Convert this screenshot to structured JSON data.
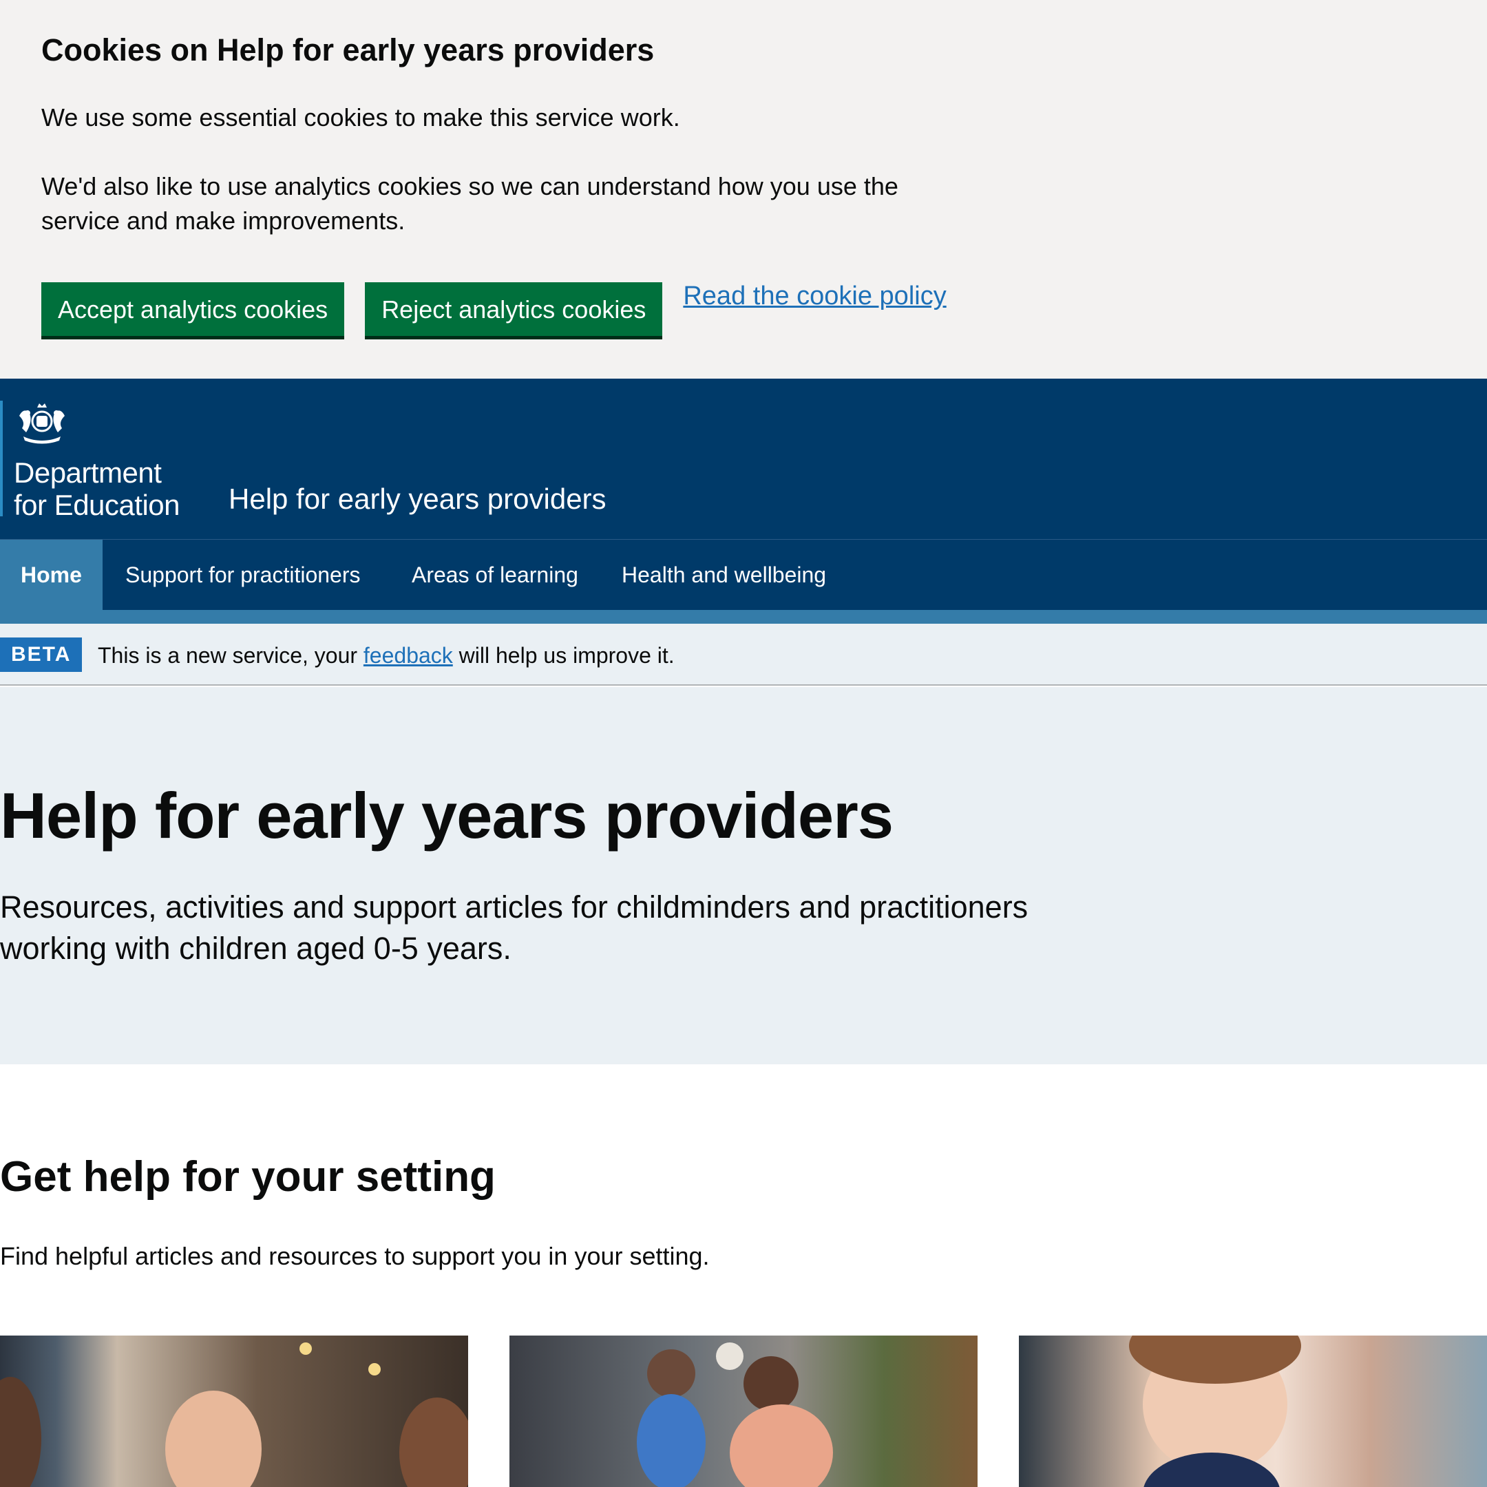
{
  "cookie_banner": {
    "title": "Cookies on Help for early years providers",
    "paragraph_1": "We use some essential cookies to make this service work.",
    "paragraph_2": "We'd also like to use analytics cookies so we can understand how you use the service and make improvements.",
    "accept_label": "Accept analytics cookies",
    "reject_label": "Reject analytics cookies",
    "policy_link": "Read the cookie policy"
  },
  "header": {
    "org_line_1": "Department",
    "org_line_2": "for Education",
    "service_name": "Help for early years providers"
  },
  "nav": {
    "items": [
      {
        "label": "Home",
        "active": true
      },
      {
        "label": "Support for practitioners",
        "active": false
      },
      {
        "label": "Areas of learning",
        "active": false
      },
      {
        "label": "Health and wellbeing",
        "active": false
      }
    ]
  },
  "beta": {
    "tag": "BETA",
    "text_before": "This is a new service, your ",
    "link": "feedback",
    "text_after": " will help us improve it."
  },
  "hero": {
    "title": "Help for early years providers",
    "subtitle": "Resources, activities and support articles for childminders and practitioners working with children aged 0-5 years."
  },
  "section": {
    "title": "Get help for your setting",
    "description": "Find helpful articles and resources to support you in your setting."
  },
  "colors": {
    "cookie_bg": "#f3f2f1",
    "button_green": "#00703c",
    "header_blue": "#003a69",
    "nav_active": "#347ca9",
    "link_blue": "#1d70b8",
    "hero_bg": "#eaf0f4"
  }
}
